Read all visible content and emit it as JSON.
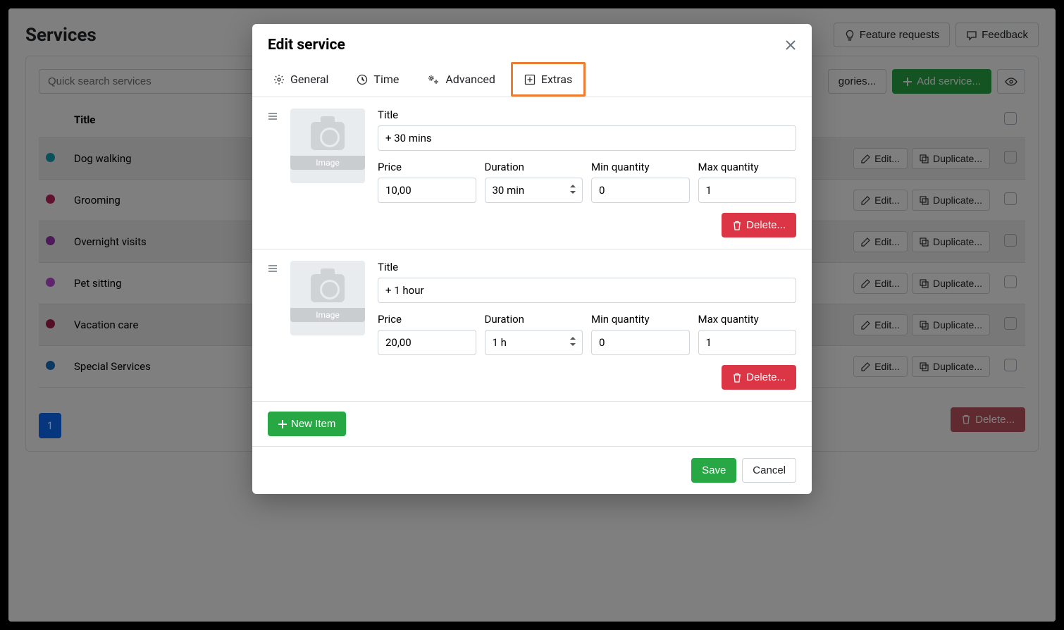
{
  "page": {
    "title": "Services",
    "feature_requests": "Feature requests",
    "feedback": "Feedback",
    "categories_btn": "gories...",
    "add_service_btn": "Add service...",
    "search_placeholder": "Quick search services",
    "table_header_title": "Title",
    "edit_label": "Edit...",
    "duplicate_label": "Duplicate...",
    "page_num": "1",
    "bottom_delete": "Delete..."
  },
  "services": [
    {
      "title": "Dog walking",
      "color": "#17a2b8"
    },
    {
      "title": "Grooming",
      "color": "#c2255c"
    },
    {
      "title": "Overnight visits",
      "color": "#9c36b5"
    },
    {
      "title": "Pet sitting",
      "color": "#be4bdb"
    },
    {
      "title": "Vacation care",
      "color": "#a61e4d"
    },
    {
      "title": "Special Services",
      "color": "#1971c2"
    }
  ],
  "modal": {
    "title": "Edit service",
    "tabs": {
      "general": "General",
      "time": "Time",
      "advanced": "Advanced",
      "extras": "Extras"
    },
    "labels": {
      "title": "Title",
      "price": "Price",
      "duration": "Duration",
      "min_qty": "Min quantity",
      "max_qty": "Max quantity",
      "image": "Image",
      "delete": "Delete...",
      "new_item": "New Item",
      "save": "Save",
      "cancel": "Cancel"
    },
    "extras": [
      {
        "title": "+ 30 mins",
        "price": "10,00",
        "duration": "30 min",
        "min": "0",
        "max": "1"
      },
      {
        "title": "+ 1 hour",
        "price": "20,00",
        "duration": "1 h",
        "min": "0",
        "max": "1"
      }
    ]
  }
}
